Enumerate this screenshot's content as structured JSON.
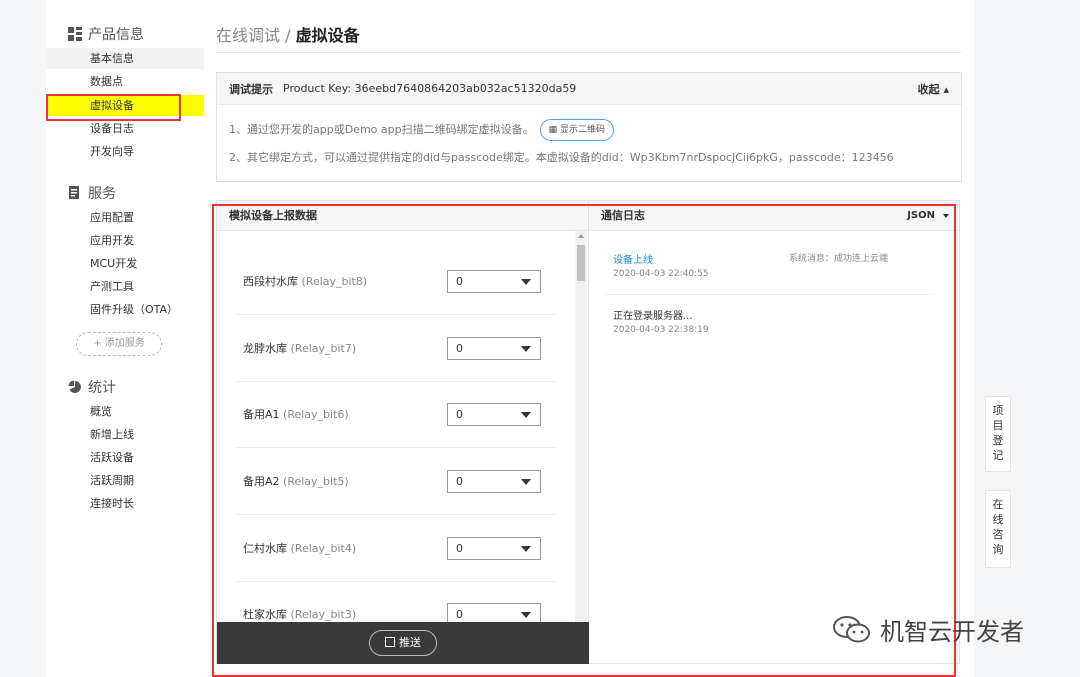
{
  "sidebar": {
    "groups": [
      {
        "title": "产品信息",
        "icon": "grid-icon",
        "items": [
          "基本信息",
          "数据点",
          "虚拟设备",
          "设备日志",
          "开发向导"
        ]
      },
      {
        "title": "服务",
        "icon": "document-icon",
        "items": [
          "应用配置",
          "应用开发",
          "MCU开发",
          "产测工具",
          "固件升级（OTA）"
        ]
      },
      {
        "title": "统计",
        "icon": "pie-chart-icon",
        "items": [
          "概览",
          "新增上线",
          "活跃设备",
          "活跃周期",
          "连接时长"
        ]
      }
    ],
    "active_item": "虚拟设备",
    "add_service": "+ 添加服务"
  },
  "header": {
    "breadcrumb_parent": "在线调试 / ",
    "breadcrumb_current": "虚拟设备"
  },
  "tip": {
    "label": "调试提示",
    "product_key": "Product Key: 36eebd7640864203ab032ac51320da59",
    "collapse": "收起 ▴",
    "line1": "1、通过您开发的app或Demo app扫描二维码绑定虚拟设备。",
    "qr_button": "显示二维码",
    "line2": "2、其它绑定方式，可以通过提供指定的did与passcode绑定。本虚拟设备的did：Wp3Kbm7nrDspocJCii6pkG，passcode：123456"
  },
  "left_panel": {
    "title": "模拟设备上报数据",
    "rows": [
      {
        "name": "西段村水库",
        "key": "(Relay_bit8)",
        "value": "0"
      },
      {
        "name": "龙脖水库",
        "key": "(Relay_bit7)",
        "value": "0"
      },
      {
        "name": "备用A1",
        "key": "(Relay_bit6)",
        "value": "0"
      },
      {
        "name": "备用A2",
        "key": "(Relay_bit5)",
        "value": "0"
      },
      {
        "name": "仁村水库",
        "key": "(Relay_bit4)",
        "value": "0"
      },
      {
        "name": "杜家水库",
        "key": "(Relay_bit3)",
        "value": "0"
      }
    ],
    "push_button": "推送"
  },
  "right_panel": {
    "title": "通信日志",
    "format": "JSON",
    "logs": [
      {
        "message": "设备上线",
        "detail": "系统消息：成功连上云端",
        "time": "2020-04-03 22:40:55",
        "highlight": true
      },
      {
        "message": "正在登录服务器...",
        "detail": "",
        "time": "2020-04-03 22:38:19",
        "highlight": false
      }
    ]
  },
  "float_buttons": [
    "项目登记",
    "在线咨询"
  ],
  "watermark": "机智云开发者",
  "colors": {
    "highlight_yellow": "#ffff00",
    "annotation_red": "#ee3333",
    "link_blue": "#1a8bd6",
    "push_bar": "#3a3a3a"
  }
}
